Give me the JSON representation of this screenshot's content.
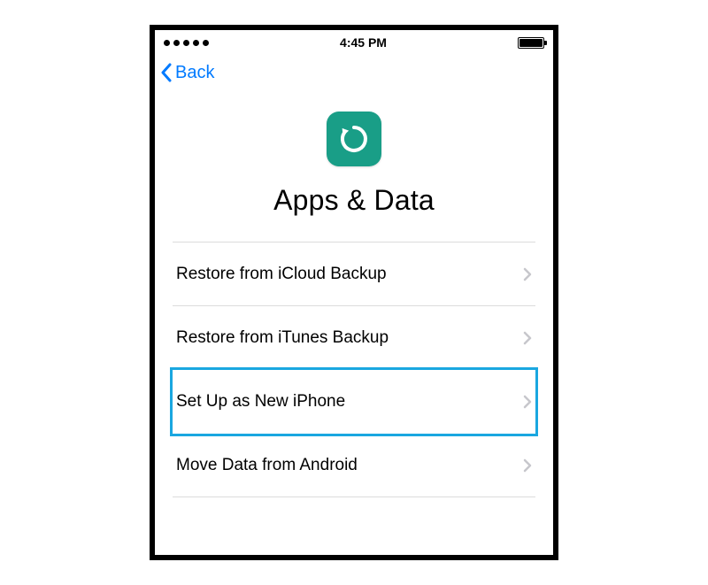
{
  "status": {
    "time": "4:45 PM"
  },
  "nav": {
    "back_label": "Back"
  },
  "header": {
    "title": "Apps & Data"
  },
  "options": [
    {
      "label": "Restore from iCloud Backup",
      "highlighted": false
    },
    {
      "label": "Restore from iTunes Backup",
      "highlighted": false
    },
    {
      "label": "Set Up as New iPhone",
      "highlighted": true
    },
    {
      "label": "Move Data from Android",
      "highlighted": false
    }
  ],
  "colors": {
    "link": "#007aff",
    "icon_bg": "#199e87",
    "highlight": "#1aa7e0"
  }
}
